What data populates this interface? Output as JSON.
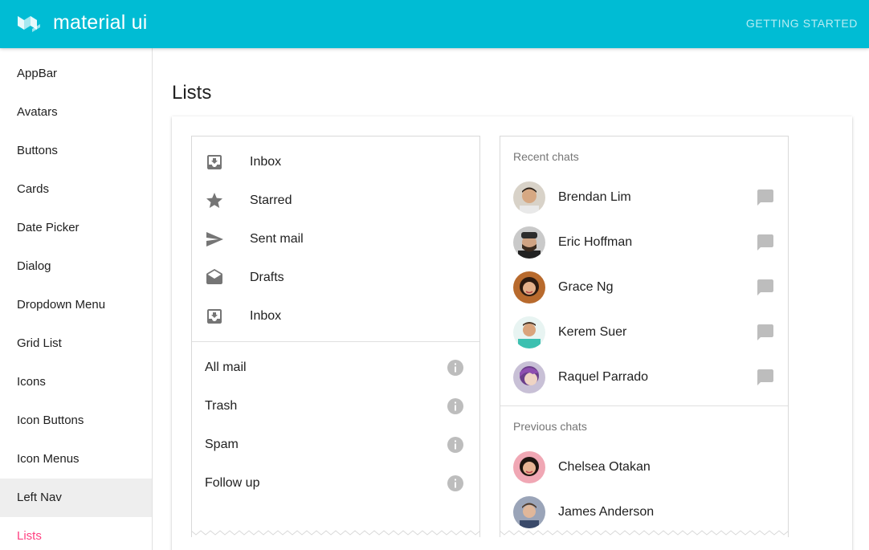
{
  "appbar": {
    "brand": "material ui",
    "getting_started": "GETTING STARTED",
    "accent": "#00bcd4"
  },
  "leftnav": {
    "items": [
      {
        "label": "AppBar"
      },
      {
        "label": "Avatars"
      },
      {
        "label": "Buttons"
      },
      {
        "label": "Cards"
      },
      {
        "label": "Date Picker"
      },
      {
        "label": "Dialog"
      },
      {
        "label": "Dropdown Menu"
      },
      {
        "label": "Grid List"
      },
      {
        "label": "Icons"
      },
      {
        "label": "Icon Buttons"
      },
      {
        "label": "Icon Menus"
      },
      {
        "label": "Left Nav"
      },
      {
        "label": "Lists"
      }
    ],
    "hovered": "Left Nav",
    "active": "Lists",
    "active_color": "#ff4081"
  },
  "page": {
    "title": "Lists"
  },
  "mail_list": {
    "primary": [
      {
        "label": "Inbox",
        "icon": "inbox-icon"
      },
      {
        "label": "Starred",
        "icon": "star-icon"
      },
      {
        "label": "Sent mail",
        "icon": "send-icon"
      },
      {
        "label": "Drafts",
        "icon": "drafts-icon"
      },
      {
        "label": "Inbox",
        "icon": "inbox-icon"
      }
    ],
    "secondary": [
      {
        "label": "All mail",
        "icon": "info-icon"
      },
      {
        "label": "Trash",
        "icon": "info-icon"
      },
      {
        "label": "Spam",
        "icon": "info-icon"
      },
      {
        "label": "Follow up",
        "icon": "info-icon"
      }
    ]
  },
  "chats": {
    "recent_header": "Recent chats",
    "recent": [
      {
        "name": "Brendan Lim"
      },
      {
        "name": "Eric Hoffman"
      },
      {
        "name": "Grace Ng"
      },
      {
        "name": "Kerem Suer"
      },
      {
        "name": "Raquel Parrado"
      }
    ],
    "previous_header": "Previous chats",
    "previous": [
      {
        "name": "Chelsea Otakan"
      },
      {
        "name": "James Anderson"
      }
    ],
    "chat_icon": "chat-bubble-icon"
  }
}
